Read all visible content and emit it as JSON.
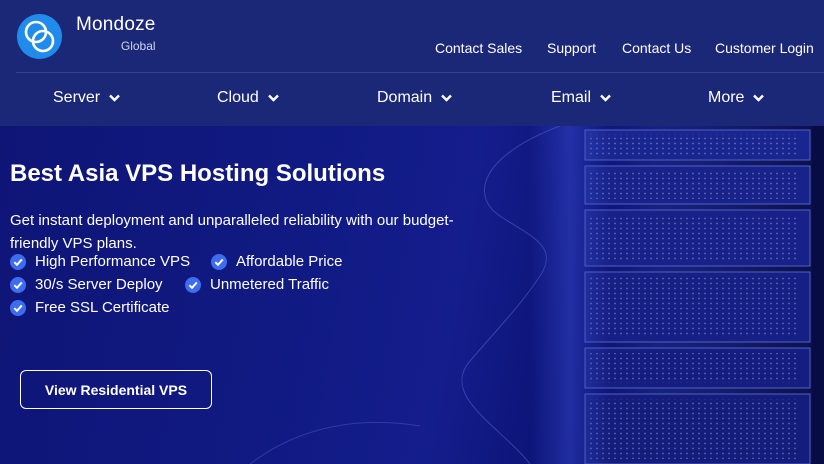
{
  "brand": {
    "name": "Mondoze",
    "sub": "Global",
    "logo_icon": "interlocking-rings-logo"
  },
  "top_links": [
    "Contact Sales",
    "Support",
    "Contact Us",
    "Customer Login"
  ],
  "nav": [
    {
      "label": "Server",
      "icon": "chevron-down-icon"
    },
    {
      "label": "Cloud",
      "icon": "chevron-down-icon"
    },
    {
      "label": "Domain",
      "icon": "chevron-down-icon"
    },
    {
      "label": "Email",
      "icon": "chevron-down-icon"
    },
    {
      "label": "More",
      "icon": "chevron-down-icon"
    }
  ],
  "hero": {
    "title": "Best Asia VPS Hosting Solutions",
    "description": "Get instant deployment and unparalleled reliability with our budget-friendly VPS plans.",
    "features": [
      "High Performance VPS",
      "Affordable Price",
      "30/s Server Deploy",
      "Unmetered Traffic",
      "Free SSL Certificate"
    ],
    "feature_icon": "check-circle-icon",
    "cta_label": "View Residential VPS"
  },
  "colors": {
    "header_bg": "#1b2878",
    "hero_bg": "#0f1577",
    "accent": "#3d6cf0",
    "logo": "#1f8cec",
    "text": "#ffffff"
  }
}
